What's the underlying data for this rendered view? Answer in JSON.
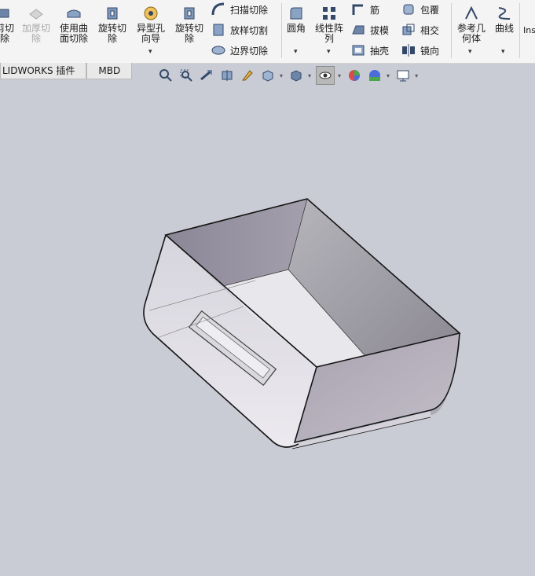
{
  "ribbon": {
    "cut_partial": "剪切\n除",
    "thicken_cut": "加厚切\n除",
    "surface_cut": "使用曲\n面切除",
    "revolved_cut": "旋转切\n除",
    "hole_wizard": "异型孔\n向导",
    "revolved_cut2": "旋转切\n除",
    "swept_cut": "扫描切除",
    "lofted_cut": "放样切割",
    "boundary_cut": "边界切除",
    "fillet": "圆角",
    "linear_pattern": "线性阵\n列",
    "rib": "筋",
    "draft": "拔模",
    "shell": "抽壳",
    "wrap": "包覆",
    "intersect": "相交",
    "mirror": "镜向",
    "ref_geometry": "参考几\n何体",
    "curves": "曲线",
    "instant3d": "Ins"
  },
  "tabs": {
    "addins": "LIDWORKS 插件",
    "mbd": "MBD"
  },
  "colors": {
    "background": "#c9ccd4",
    "ribbon": "#f4f4f4",
    "model_face": "#e4e2e6",
    "model_shadow": "#8d8895",
    "model_edge": "#151515"
  },
  "view_icons": [
    "zoom-to-fit-icon",
    "zoom-area-icon",
    "previous-view-icon",
    "section-view-icon",
    "dynamic-annotation-icon",
    "view-orientation-icon",
    "display-style-icon",
    "hide-show-icon",
    "edit-appearance-icon",
    "apply-scene-icon",
    "view-settings-icon"
  ]
}
